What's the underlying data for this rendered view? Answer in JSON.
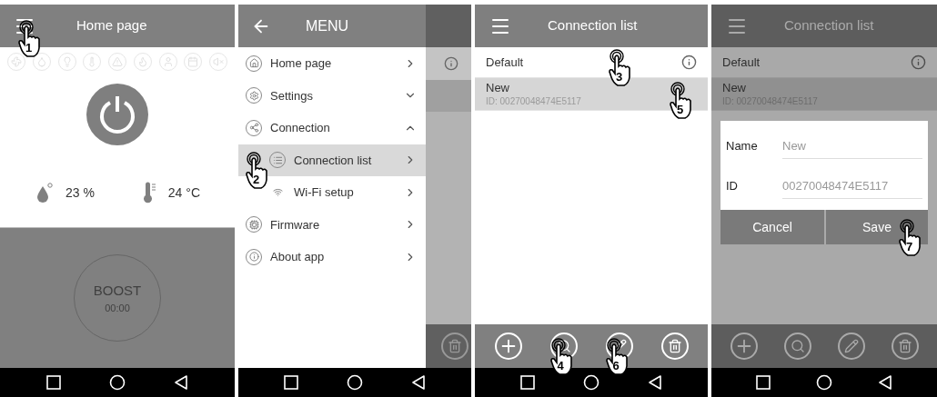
{
  "screens": [
    {
      "kind": "home",
      "title": "Home page",
      "menu_step": "1",
      "humidity": "23 %",
      "temperature": "24 °C",
      "boost": {
        "label": "BOOST",
        "time": "00:00"
      }
    },
    {
      "kind": "menu",
      "title": "MENU",
      "items": [
        {
          "label": "Home page",
          "kind": "link",
          "selected": false
        },
        {
          "label": "Settings",
          "kind": "group",
          "expanded": false,
          "selected": false
        },
        {
          "label": "Connection",
          "kind": "group",
          "expanded": true,
          "selected": false,
          "children": [
            {
              "label": "Connection list",
              "kind": "link",
              "selected": true,
              "step": "2"
            },
            {
              "label": "Wi-Fi setup",
              "kind": "link",
              "selected": false
            }
          ]
        },
        {
          "label": "Firmware",
          "kind": "link",
          "selected": false
        },
        {
          "label": "About app",
          "kind": "link",
          "selected": false
        }
      ]
    },
    {
      "kind": "list",
      "title": "Connection list",
      "dialog_open": false,
      "connections": [
        {
          "name": "Default",
          "info_button": true,
          "selected": false,
          "step": "3"
        },
        {
          "name": "New",
          "id": "ID: 00270048474E5117",
          "info_button": false,
          "selected": true,
          "step": "5"
        }
      ],
      "toolbar": [
        {
          "kind": "add"
        },
        {
          "kind": "search",
          "step": "4"
        },
        {
          "kind": "edit",
          "step": "6"
        },
        {
          "kind": "delete"
        }
      ]
    },
    {
      "kind": "list",
      "title": "Connection list",
      "dialog_open": true,
      "connections": [
        {
          "name": "Default",
          "info_button": true,
          "selected": false
        },
        {
          "name": "New",
          "id": "ID: 00270048474E5117",
          "info_button": false,
          "selected": true
        }
      ],
      "toolbar": [
        {
          "kind": "add"
        },
        {
          "kind": "search"
        },
        {
          "kind": "edit"
        },
        {
          "kind": "delete"
        }
      ],
      "dialog": {
        "fields": [
          {
            "label": "Name",
            "value": "New"
          },
          {
            "label": "ID",
            "value": "00270048474E5117"
          }
        ],
        "buttons": [
          {
            "label": "Cancel"
          },
          {
            "label": "Save",
            "step": "7"
          }
        ]
      }
    }
  ]
}
